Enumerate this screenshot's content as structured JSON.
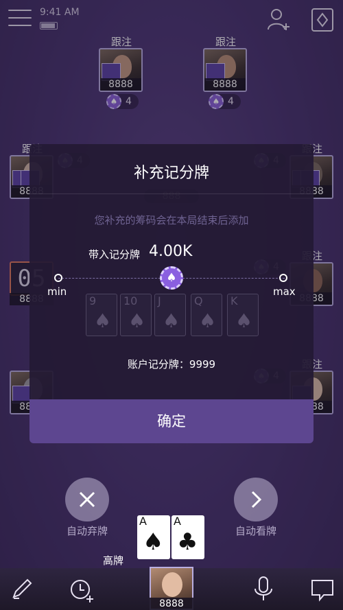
{
  "status_bar": {
    "time": "9:41 AM"
  },
  "seats": [
    {
      "status": "跟注",
      "chips": "8888",
      "badge": "4"
    },
    {
      "status": "跟注",
      "chips": "8888",
      "badge": "4"
    },
    {
      "status": "跟注",
      "chips": "8888",
      "badge": "4"
    },
    {
      "status": "跟注",
      "chips": "8888",
      "badge": "4"
    },
    {
      "timer": "05",
      "chips": "8888"
    },
    {
      "status": "跟注",
      "chips": "8888",
      "badge": "4"
    },
    {
      "chips": "8888",
      "badge": "4"
    },
    {
      "status": "跟注",
      "chips": "8888",
      "badge": "4"
    }
  ],
  "pot": "888",
  "modal": {
    "title": "补充记分牌",
    "hint": "您补充的筹码会在本局结束后添加",
    "buyin_label": "带入记分牌",
    "buyin_value": "4.00K",
    "slider_min": "min",
    "slider_max": "max",
    "slider_level": 0.5,
    "account_label": "账户记分牌：9999",
    "confirm": "确定"
  },
  "ghost_cards": [
    "9",
    "10",
    "J",
    "Q",
    "K"
  ],
  "actions": {
    "fold_label": "自动弃牌",
    "check_label": "自动看牌"
  },
  "hand": {
    "label": "高牌",
    "cards": [
      {
        "rank": "A",
        "suit": "♠"
      },
      {
        "rank": "A",
        "suit": "♣"
      }
    ]
  },
  "self": {
    "chips": "8888"
  },
  "colors": {
    "accent": "#8a5fe0",
    "confirm": "#5d4690",
    "background": "#4b3672"
  }
}
